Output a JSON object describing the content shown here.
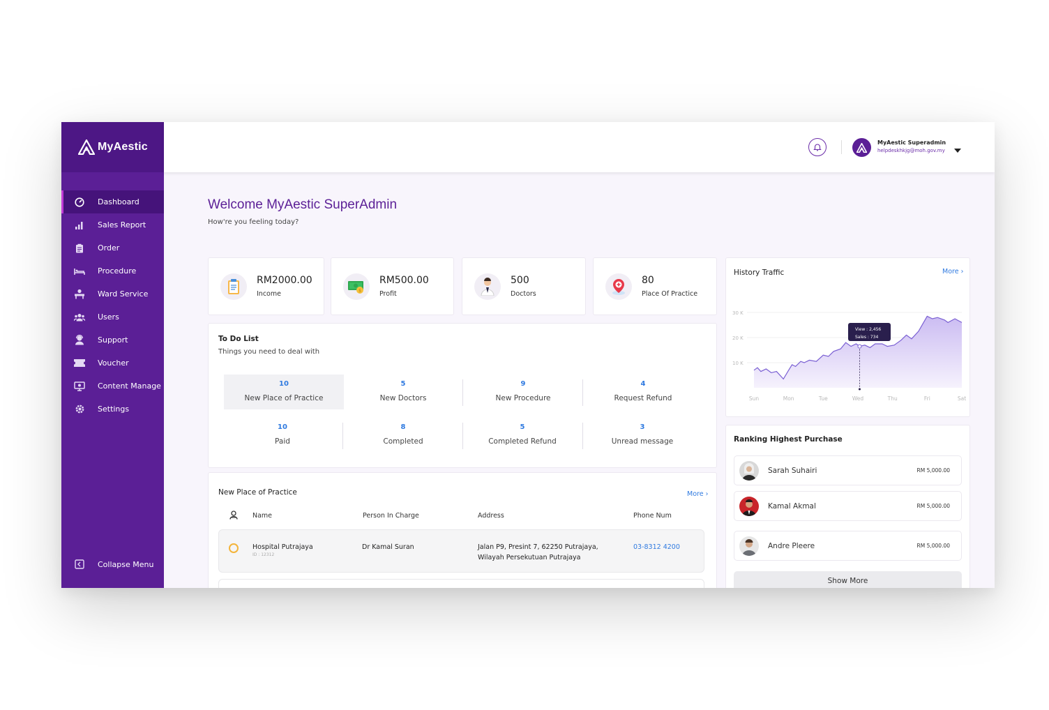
{
  "brand": {
    "name": "MyAestic"
  },
  "sidebar": {
    "items": [
      {
        "label": "Dashboard",
        "icon": "gauge-icon",
        "active": true
      },
      {
        "label": "Sales Report",
        "icon": "bar-chart-icon"
      },
      {
        "label": "Order",
        "icon": "clipboard-icon"
      },
      {
        "label": "Procedure",
        "icon": "bed-icon"
      },
      {
        "label": "Ward Service",
        "icon": "ward-icon"
      },
      {
        "label": "Users",
        "icon": "users-icon"
      },
      {
        "label": "Support",
        "icon": "support-icon"
      },
      {
        "label": "Voucher",
        "icon": "ticket-icon"
      },
      {
        "label": "Content Manage",
        "icon": "monitor-icon"
      },
      {
        "label": "Settings",
        "icon": "gear-icon"
      }
    ],
    "collapse_label": "Collapse Menu"
  },
  "header": {
    "user_name": "MyAestic Superadmin",
    "user_email": "helpdeskhkjg@moh.gov.my"
  },
  "welcome": {
    "title": "Welcome MyAestic SuperAdmin",
    "subtitle": "How're you feeling today?"
  },
  "stats": [
    {
      "value": "RM2000.00",
      "label": "Income",
      "icon": "clipboard-icon"
    },
    {
      "value": "RM500.00",
      "label": "Profit",
      "icon": "money-icon"
    },
    {
      "value": "500",
      "label": "Doctors",
      "icon": "doctor-icon"
    },
    {
      "value": "80",
      "label": "Place Of Practice",
      "icon": "location-pin-icon"
    }
  ],
  "todo": {
    "title": "To Do List",
    "subtitle": "Things you need to deal with",
    "items": [
      {
        "count": "10",
        "label": "New Place of Practice"
      },
      {
        "count": "5",
        "label": "New Doctors"
      },
      {
        "count": "9",
        "label": "New Procedure"
      },
      {
        "count": "4",
        "label": "Request Refund"
      },
      {
        "count": "10",
        "label": "Paid"
      },
      {
        "count": "8",
        "label": "Completed"
      },
      {
        "count": "5",
        "label": "Completed Refund"
      },
      {
        "count": "3",
        "label": "Unread message"
      }
    ]
  },
  "practice": {
    "title": "New Place of Practice",
    "more_label": "More",
    "headers": [
      "Name",
      "Person In Charge",
      "Address",
      "Phone Num"
    ],
    "rows": [
      {
        "name": "Hospital Putrajaya",
        "id": "ID : 12312",
        "person": "Dr Kamal Suran",
        "address_line1": "Jalan P9, Presint 7, 62250 Putrajaya,",
        "address_line2": "Wilayah Persekutuan Putrajaya",
        "phone": "03-8312 4200"
      }
    ]
  },
  "traffic": {
    "title": "History Traffic",
    "more_label": "More",
    "tooltip_view": "View : 2,456",
    "tooltip_sales": "Sales : 734"
  },
  "chart_data": {
    "type": "area",
    "title": "History Traffic",
    "x": [
      "Sun",
      "Mon",
      "Tue",
      "Wed",
      "Thu",
      "Fri",
      "Sat"
    ],
    "y_ticks": [
      "10 K",
      "20 K",
      "30 K"
    ],
    "ylim": [
      0,
      30000
    ],
    "grid": true,
    "points": [
      [
        0.0,
        7000
      ],
      [
        0.1,
        8000
      ],
      [
        0.2,
        6500
      ],
      [
        0.35,
        7500
      ],
      [
        0.5,
        6000
      ],
      [
        0.65,
        6500
      ],
      [
        0.85,
        3500
      ],
      [
        1.0,
        7000
      ],
      [
        1.1,
        9200
      ],
      [
        1.2,
        8500
      ],
      [
        1.35,
        10500
      ],
      [
        1.45,
        10000
      ],
      [
        1.6,
        11000
      ],
      [
        1.8,
        10500
      ],
      [
        2.0,
        13000
      ],
      [
        2.15,
        12500
      ],
      [
        2.3,
        14500
      ],
      [
        2.5,
        15500
      ],
      [
        2.65,
        18000
      ],
      [
        2.8,
        16500
      ],
      [
        2.95,
        17500
      ],
      [
        3.05,
        16500
      ],
      [
        3.2,
        17000
      ],
      [
        3.35,
        16000
      ],
      [
        3.5,
        17500
      ],
      [
        3.7,
        17500
      ],
      [
        3.85,
        16500
      ],
      [
        4.05,
        17000
      ],
      [
        4.25,
        19000
      ],
      [
        4.4,
        21000
      ],
      [
        4.55,
        19500
      ],
      [
        4.75,
        22500
      ],
      [
        5.0,
        28500
      ],
      [
        5.15,
        27500
      ],
      [
        5.3,
        28000
      ],
      [
        5.5,
        27000
      ],
      [
        5.6,
        26000
      ],
      [
        5.8,
        27500
      ],
      [
        6.0,
        26000
      ]
    ],
    "highlight": {
      "x": 3.05,
      "view": 2456,
      "sales": 734
    }
  },
  "ranking": {
    "title": "Ranking Highest Purchase",
    "items": [
      {
        "name": "Sarah Suhairi",
        "amount": "RM 5,000.00"
      },
      {
        "name": "Kamal Akmal",
        "amount": "RM 5,000.00"
      },
      {
        "name": "Andre Pleere",
        "amount": "RM 5,000.00"
      }
    ],
    "show_more_label": "Show More"
  },
  "colors": {
    "sidebar": "#5b1f96",
    "brand_bar": "#4d1785",
    "accent": "#5b1f96",
    "link": "#2f7ae0",
    "active_marker": "#c13bd6",
    "chart_fill": "#d9cdf5",
    "chart_line": "#7a5fd3"
  }
}
